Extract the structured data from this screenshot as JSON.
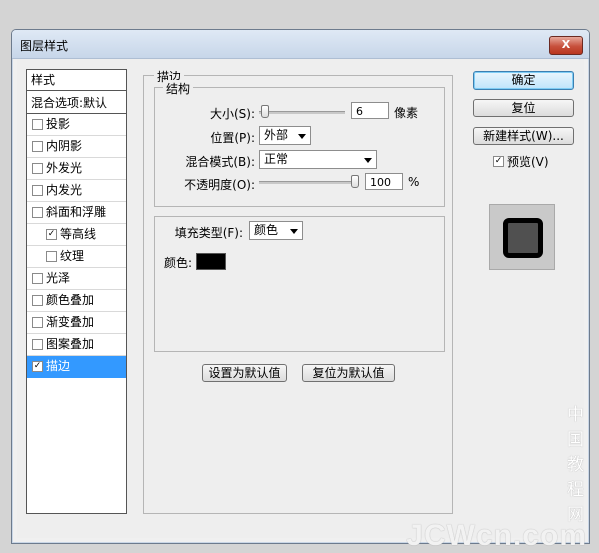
{
  "window": {
    "title": "图层样式",
    "close_label": "X"
  },
  "style_list": {
    "header": "样式",
    "blend_options": "混合选项:默认",
    "items": [
      {
        "label": "投影",
        "checked": false,
        "sub": false,
        "selected": false
      },
      {
        "label": "内阴影",
        "checked": false,
        "sub": false,
        "selected": false
      },
      {
        "label": "外发光",
        "checked": false,
        "sub": false,
        "selected": false
      },
      {
        "label": "内发光",
        "checked": false,
        "sub": false,
        "selected": false
      },
      {
        "label": "斜面和浮雕",
        "checked": false,
        "sub": false,
        "selected": false
      },
      {
        "label": "等高线",
        "checked": true,
        "sub": true,
        "selected": false
      },
      {
        "label": "纹理",
        "checked": false,
        "sub": true,
        "selected": false
      },
      {
        "label": "光泽",
        "checked": false,
        "sub": false,
        "selected": false
      },
      {
        "label": "颜色叠加",
        "checked": false,
        "sub": false,
        "selected": false
      },
      {
        "label": "渐变叠加",
        "checked": false,
        "sub": false,
        "selected": false
      },
      {
        "label": "图案叠加",
        "checked": false,
        "sub": false,
        "selected": false
      },
      {
        "label": "描边",
        "checked": true,
        "sub": false,
        "selected": true
      }
    ]
  },
  "stroke": {
    "title": "描边",
    "structure": {
      "title": "结构",
      "size_label": "大小(S):",
      "size_value": "6",
      "size_unit": "像素",
      "size_slider": 0.02,
      "position_label": "位置(P):",
      "position_value": "外部",
      "blend_label": "混合模式(B):",
      "blend_value": "正常",
      "opacity_label": "不透明度(O):",
      "opacity_value": "100",
      "opacity_unit": "%",
      "opacity_slider": 1.0
    },
    "fill": {
      "type_label": "填充类型(F):",
      "type_value": "颜色",
      "color_label": "颜色:",
      "color": "#000000"
    },
    "set_default": "设置为默认值",
    "reset_default": "复位为默认值"
  },
  "buttons": {
    "ok": "确定",
    "reset": "复位",
    "new_style": "新建样式(W)...",
    "preview_label": "预览(V)",
    "preview_checked": true
  },
  "watermark": {
    "line1": "中国教程网",
    "line2": "JCWcn.com"
  }
}
